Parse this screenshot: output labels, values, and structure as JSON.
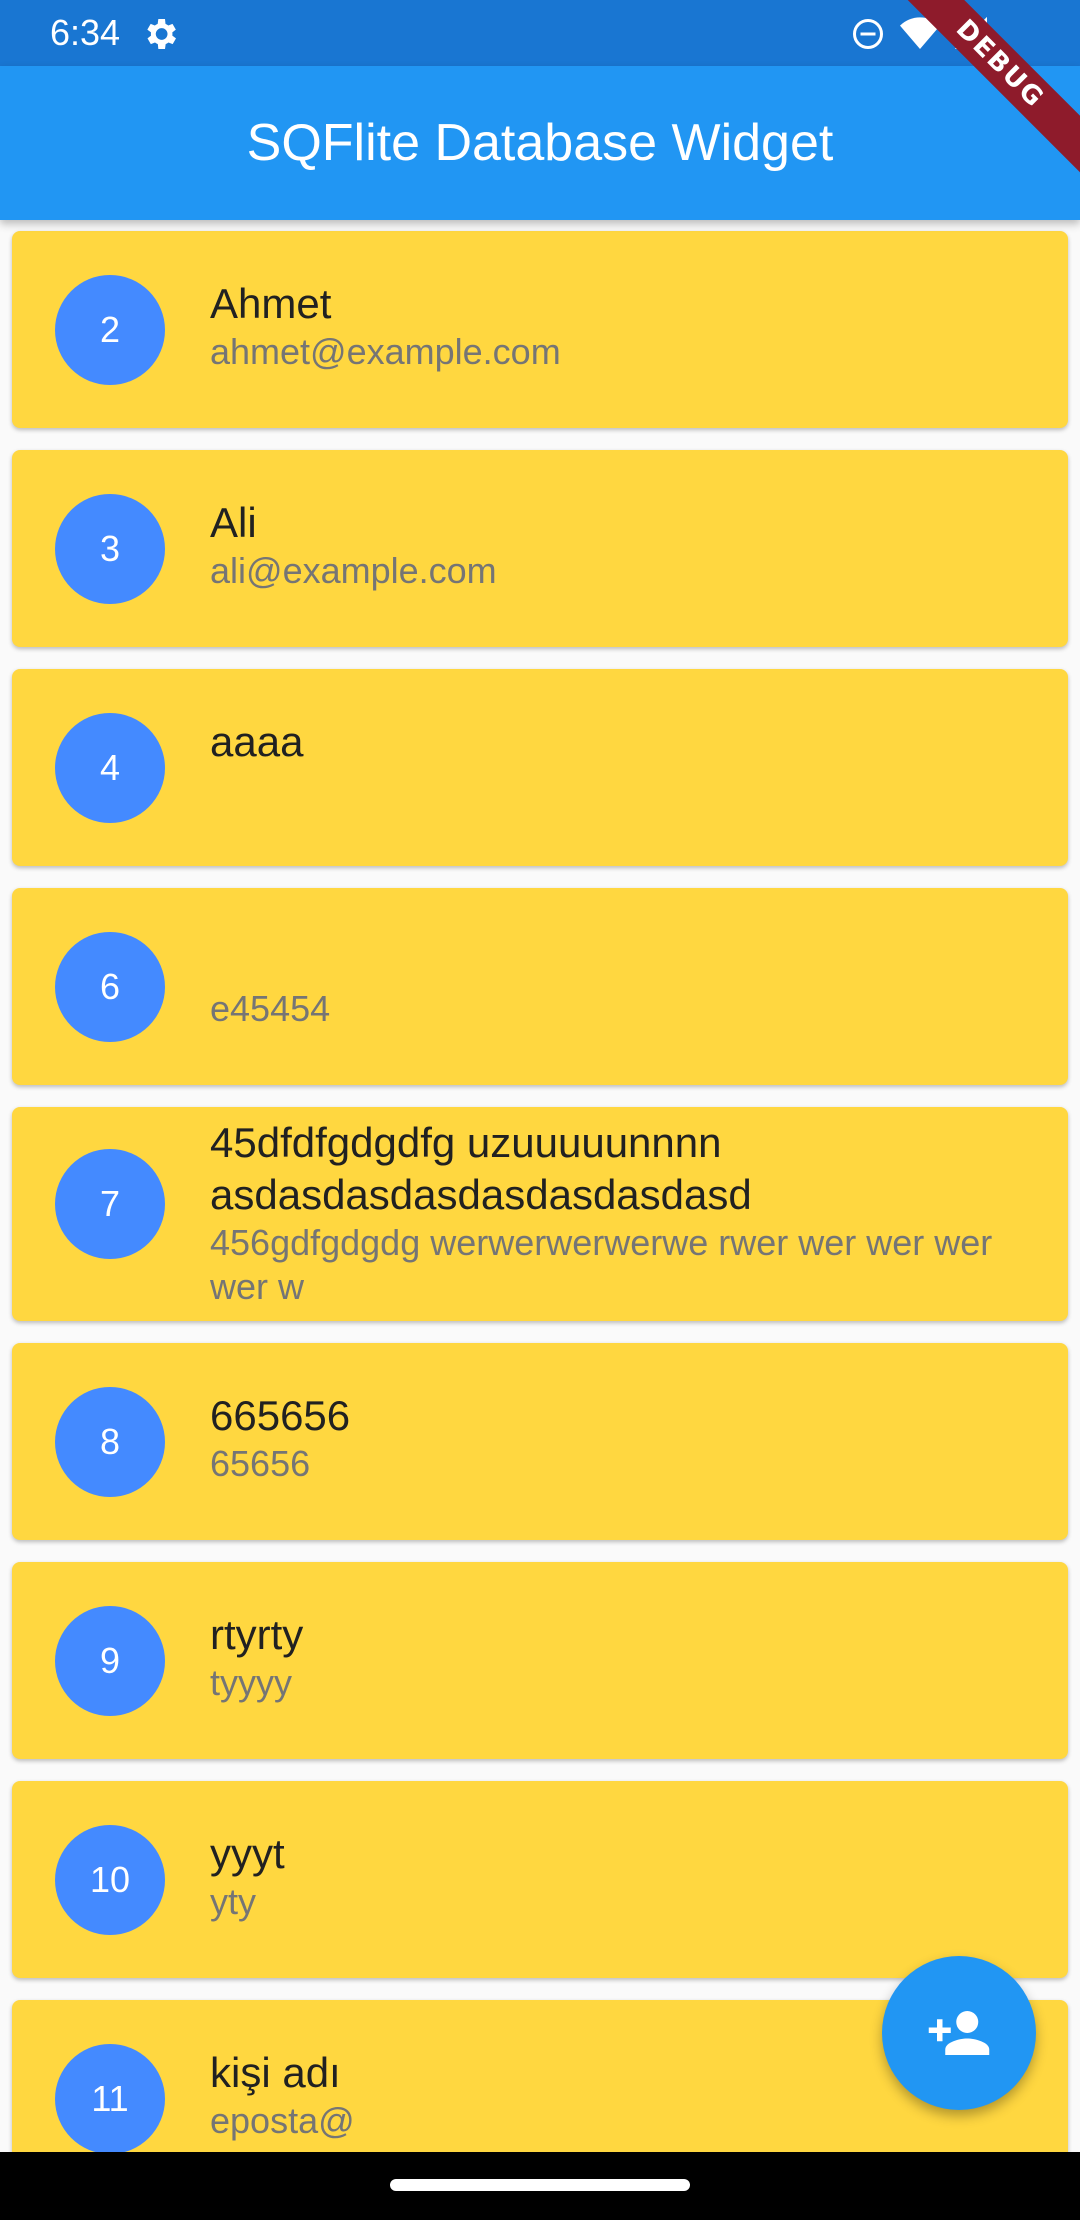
{
  "status_bar": {
    "time": "6:34"
  },
  "debug_banner": "DEBUG",
  "app_bar": {
    "title": "SQFlite Database Widget"
  },
  "users": [
    {
      "id": "2",
      "name": "Ahmet",
      "email": "ahmet@example.com"
    },
    {
      "id": "3",
      "name": "Ali",
      "email": "ali@example.com"
    },
    {
      "id": "4",
      "name": "aaaa",
      "email": ""
    },
    {
      "id": "6",
      "name": "",
      "email": "e45454"
    },
    {
      "id": "7",
      "name": "45dfdfgdgdfg uzuuuuunnnn asdasdasdasdasdasdasdasd",
      "email": "456gdfgdgdg werwerwerwerwe rwer wer wer wer wer w"
    },
    {
      "id": "8",
      "name": "665656",
      "email": "65656"
    },
    {
      "id": "9",
      "name": "rtyrty",
      "email": "tyyyy"
    },
    {
      "id": "10",
      "name": "yyyt",
      "email": "yty"
    },
    {
      "id": "11",
      "name": "kişi adı",
      "email": "eposta@"
    }
  ],
  "fab": {
    "icon": "person-add-icon"
  },
  "colors": {
    "status_bar": "#1976D2",
    "app_bar": "#2196F3",
    "card": "#FFD740",
    "avatar": "#448AFF",
    "fab": "#2196F3"
  }
}
